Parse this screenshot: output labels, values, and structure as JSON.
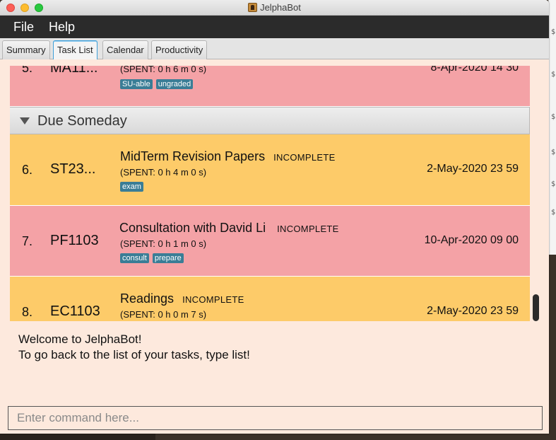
{
  "window": {
    "title": "JelphaBot"
  },
  "menu": {
    "file": "File",
    "help": "Help"
  },
  "tabs": [
    {
      "label": "Summary"
    },
    {
      "label": "Task List"
    },
    {
      "label": "Calendar"
    },
    {
      "label": "Productivity"
    }
  ],
  "tasks": [
    {
      "index": "5.",
      "code": "MA11...",
      "name": "",
      "status": "",
      "spent": "(SPENT: 0 h 6 m 0 s)",
      "tags": [
        "SU-able",
        "ungraded"
      ],
      "due": "8-Apr-2020 14 30"
    },
    {
      "index": "6.",
      "code": "ST23...",
      "name": "MidTerm Revision Papers",
      "status": "INCOMPLETE",
      "spent": "(SPENT: 0 h 4 m 0 s)",
      "tags": [
        "exam"
      ],
      "due": "2-May-2020 23 59"
    },
    {
      "index": "7.",
      "code": "PF1103",
      "name": "Consultation with David Li",
      "status": "INCOMPLETE",
      "spent": "(SPENT: 0 h 1 m 0 s)",
      "tags": [
        "consult",
        "prepare"
      ],
      "due": "10-Apr-2020 09 00"
    },
    {
      "index": "8.",
      "code": "EC1103",
      "name": "Readings",
      "status": "INCOMPLETE",
      "spent": "(SPENT: 0 h 0 m 7 s)",
      "tags": [],
      "due": "2-May-2020 23 59"
    }
  ],
  "group": {
    "label": "Due Someday"
  },
  "output": {
    "line1": "Welcome to JelphaBot!",
    "line2": "To go back to the list of your tasks, type list!"
  },
  "command": {
    "placeholder": "Enter command here..."
  },
  "colors": {
    "overdue": "#f4a2a6",
    "pending": "#fdcb69",
    "tag": "#3a7d96",
    "menubar": "#2b2b2b"
  }
}
